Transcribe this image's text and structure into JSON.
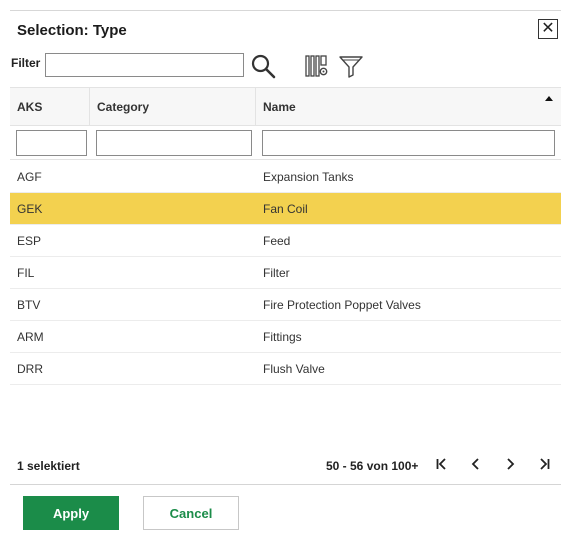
{
  "dialog": {
    "title": "Selection: Type",
    "close_glyph": "✕"
  },
  "toolbar": {
    "filter_label": "Filter",
    "filter_value": "",
    "search_icon": "search-icon",
    "columns_icon": "columns-settings-icon",
    "funnel_icon": "filter-funnel-icon"
  },
  "grid": {
    "columns": [
      "AKS",
      "Category",
      "Name"
    ],
    "sort": {
      "column": "Name",
      "direction": "ascending"
    },
    "rows": [
      {
        "aks": "AGF",
        "category": "",
        "name": "Expansion Tanks",
        "selected": false
      },
      {
        "aks": "GEK",
        "category": "",
        "name": "Fan Coil",
        "selected": true
      },
      {
        "aks": "ESP",
        "category": "",
        "name": "Feed",
        "selected": false
      },
      {
        "aks": "FIL",
        "category": "",
        "name": "Filter",
        "selected": false
      },
      {
        "aks": "BTV",
        "category": "",
        "name": "Fire Protection Poppet Valves",
        "selected": false
      },
      {
        "aks": "ARM",
        "category": "",
        "name": "Fittings",
        "selected": false
      },
      {
        "aks": "DRR",
        "category": "",
        "name": "Flush Valve",
        "selected": false
      }
    ],
    "selected_color": "#f3d14f"
  },
  "footer": {
    "selected_count": "1 selektiert",
    "paging_info": "50 - 56 von 100+"
  },
  "actions": {
    "apply_label": "Apply",
    "cancel_label": "Cancel",
    "apply_color": "#1b8c49"
  }
}
